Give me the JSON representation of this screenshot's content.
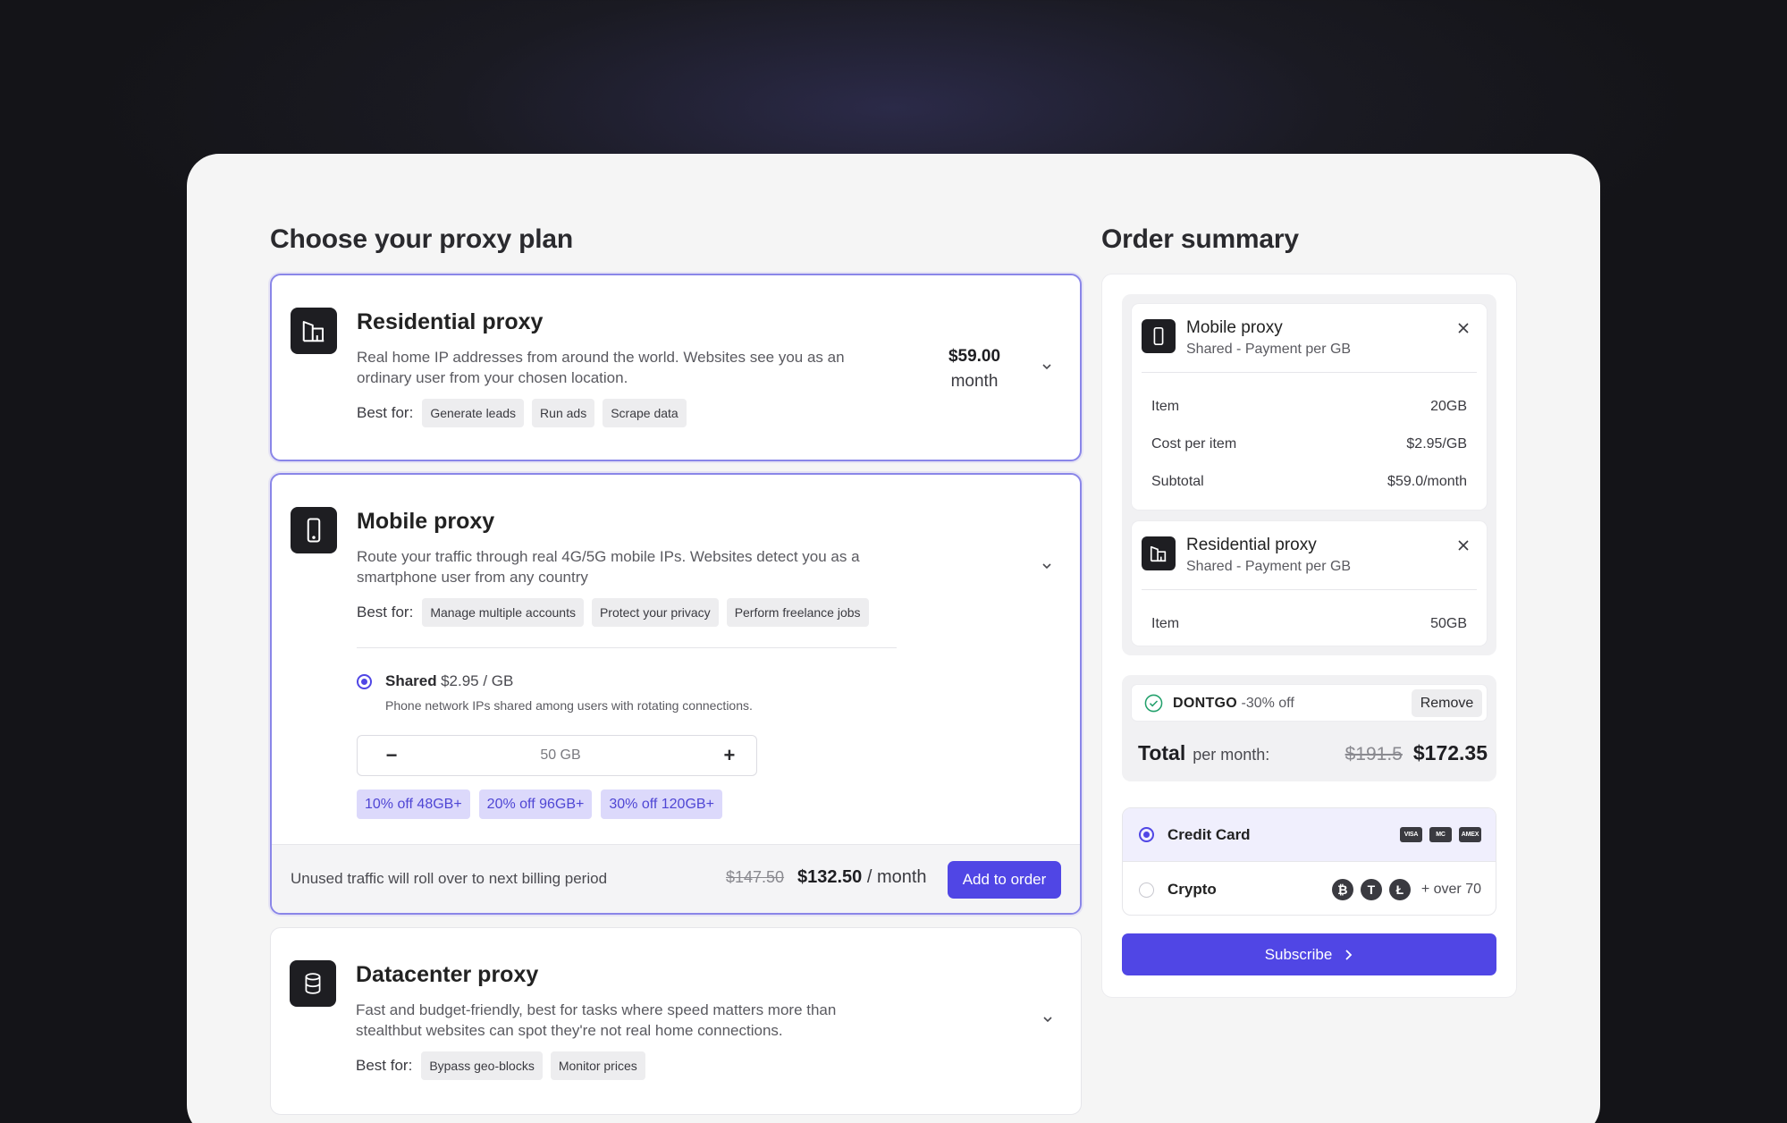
{
  "plans_section": {
    "title": "Choose your proxy plan",
    "best_for_label": "Best for:"
  },
  "residential": {
    "title": "Residential proxy",
    "description": "Real home IP addresses from around the world. Websites see you as an ordinary user from your chosen location.",
    "tags": [
      "Generate leads",
      "Run ads",
      "Scrape data"
    ],
    "price": "$59.00",
    "price_unit": "month",
    "icon": "building-icon"
  },
  "mobile": {
    "title": "Mobile proxy",
    "description": "Route your traffic through real 4G/5G mobile IPs. Websites detect you as a smartphone user from any country",
    "tags": [
      "Manage multiple accounts",
      "Protect your privacy",
      "Perform freelance jobs"
    ],
    "option": {
      "name": "Shared",
      "price": "$2.95 / GB",
      "note": "Phone network IPs shared among users with rotating connections."
    },
    "stepper": {
      "minus": "−",
      "value": "50 GB",
      "plus": "+"
    },
    "discounts": [
      "10% off 48GB+",
      "20% off 96GB+",
      "30% off 120GB+"
    ],
    "footer": {
      "note": "Unused traffic will roll over to next billing period",
      "old_price": "$147.50",
      "new_price": "$132.50",
      "per": "/ month",
      "add_label": "Add to order"
    },
    "icon": "smartphone-icon"
  },
  "datacenter": {
    "title": "Datacenter proxy",
    "description": "Fast and budget-friendly, best for tasks where speed matters more than stealthbut websites can spot they're not real home connections.",
    "tags": [
      "Bypass geo-blocks",
      "Monitor prices"
    ],
    "icon": "database-icon"
  },
  "summary": {
    "title": "Order summary",
    "items": [
      {
        "title": "Mobile proxy",
        "subtitle": "Shared - Payment per GB",
        "rows": [
          {
            "label": "Item",
            "value": "20GB"
          },
          {
            "label": "Cost per item",
            "value": "$2.95/GB"
          },
          {
            "label": "Subtotal",
            "value": "$59.0/month"
          }
        ]
      },
      {
        "title": "Residential proxy",
        "subtitle": "Shared - Payment per GB",
        "rows": [
          {
            "label": "Item",
            "value": "50GB"
          }
        ]
      }
    ],
    "promo": {
      "code": "DONTGO",
      "discount": "-30% off",
      "remove_label": "Remove"
    },
    "total": {
      "label": "Total",
      "per": "per month:",
      "old": "$191.5",
      "new": "$172.35"
    },
    "payment": {
      "card_label": "Credit Card",
      "card_brands": [
        "VISA",
        "MC",
        "AMEX"
      ],
      "crypto_label": "Crypto",
      "crypto_coins": [
        "₿",
        "T",
        "Ł"
      ],
      "crypto_more": "+ over 70"
    },
    "subscribe_label": "Subscribe"
  },
  "colors": {
    "accent": "#5046e5",
    "accent_soft": "#dcd9fb",
    "border_selected": "#8a86e8",
    "success": "#22a06b"
  }
}
